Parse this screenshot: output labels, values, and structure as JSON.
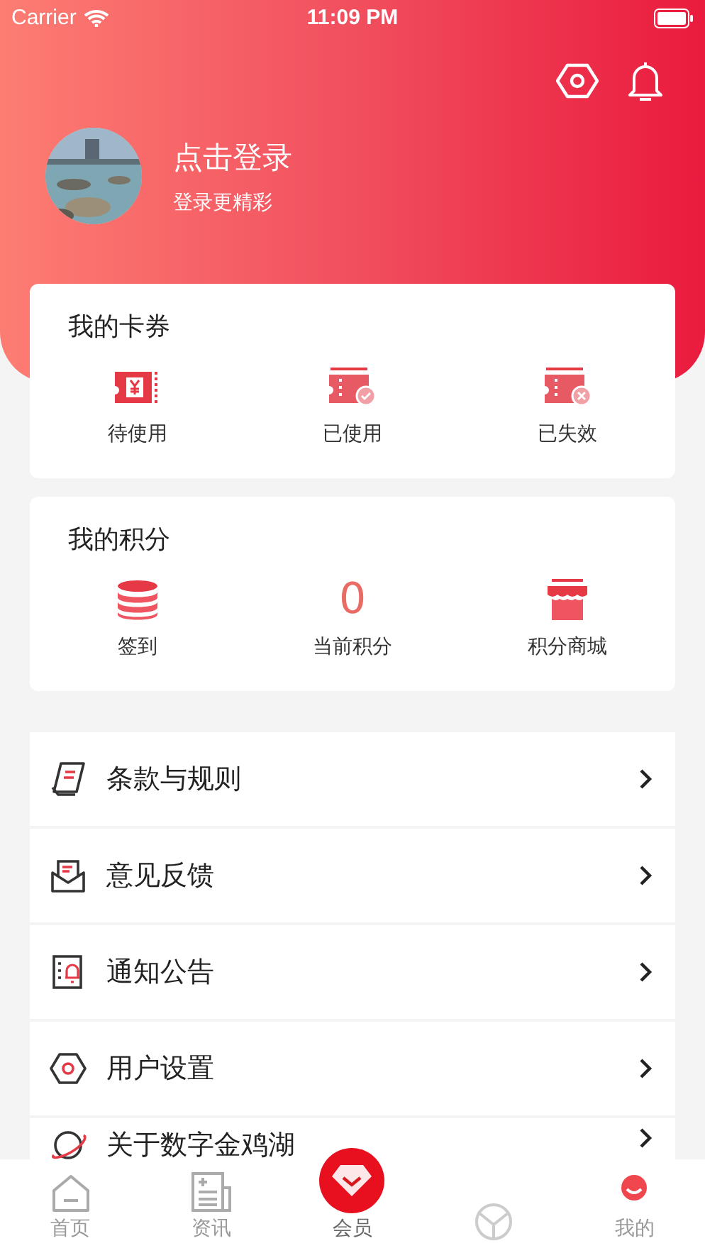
{
  "status_bar": {
    "carrier": "Carrier",
    "time": "11:09 PM"
  },
  "profile": {
    "title": "点击登录",
    "subtitle": "登录更精彩"
  },
  "coupons": {
    "title": "我的卡券",
    "items": [
      {
        "kind": "pending",
        "label": "待使用"
      },
      {
        "kind": "used",
        "label": "已使用"
      },
      {
        "kind": "expired",
        "label": "已失效"
      }
    ]
  },
  "points": {
    "title": "我的积分",
    "items": [
      {
        "kind": "checkin",
        "label": "签到"
      },
      {
        "kind": "value",
        "value": "0",
        "label": "当前积分"
      },
      {
        "kind": "shop",
        "label": "积分商城"
      }
    ]
  },
  "menu": [
    {
      "kind": "terms",
      "label": "条款与规则"
    },
    {
      "kind": "feedback",
      "label": "意见反馈"
    },
    {
      "kind": "notice",
      "label": "通知公告"
    },
    {
      "kind": "settings",
      "label": "用户设置"
    },
    {
      "kind": "about",
      "label": "关于数字金鸡湖"
    }
  ],
  "tab_bar": [
    {
      "kind": "home",
      "label": "首页",
      "selected": false
    },
    {
      "kind": "news",
      "label": "资讯",
      "selected": false
    },
    {
      "kind": "member",
      "label": "会员",
      "selected": true
    },
    {
      "kind": "globe",
      "selected": false
    },
    {
      "kind": "me",
      "label": "我的",
      "selected": false
    }
  ]
}
